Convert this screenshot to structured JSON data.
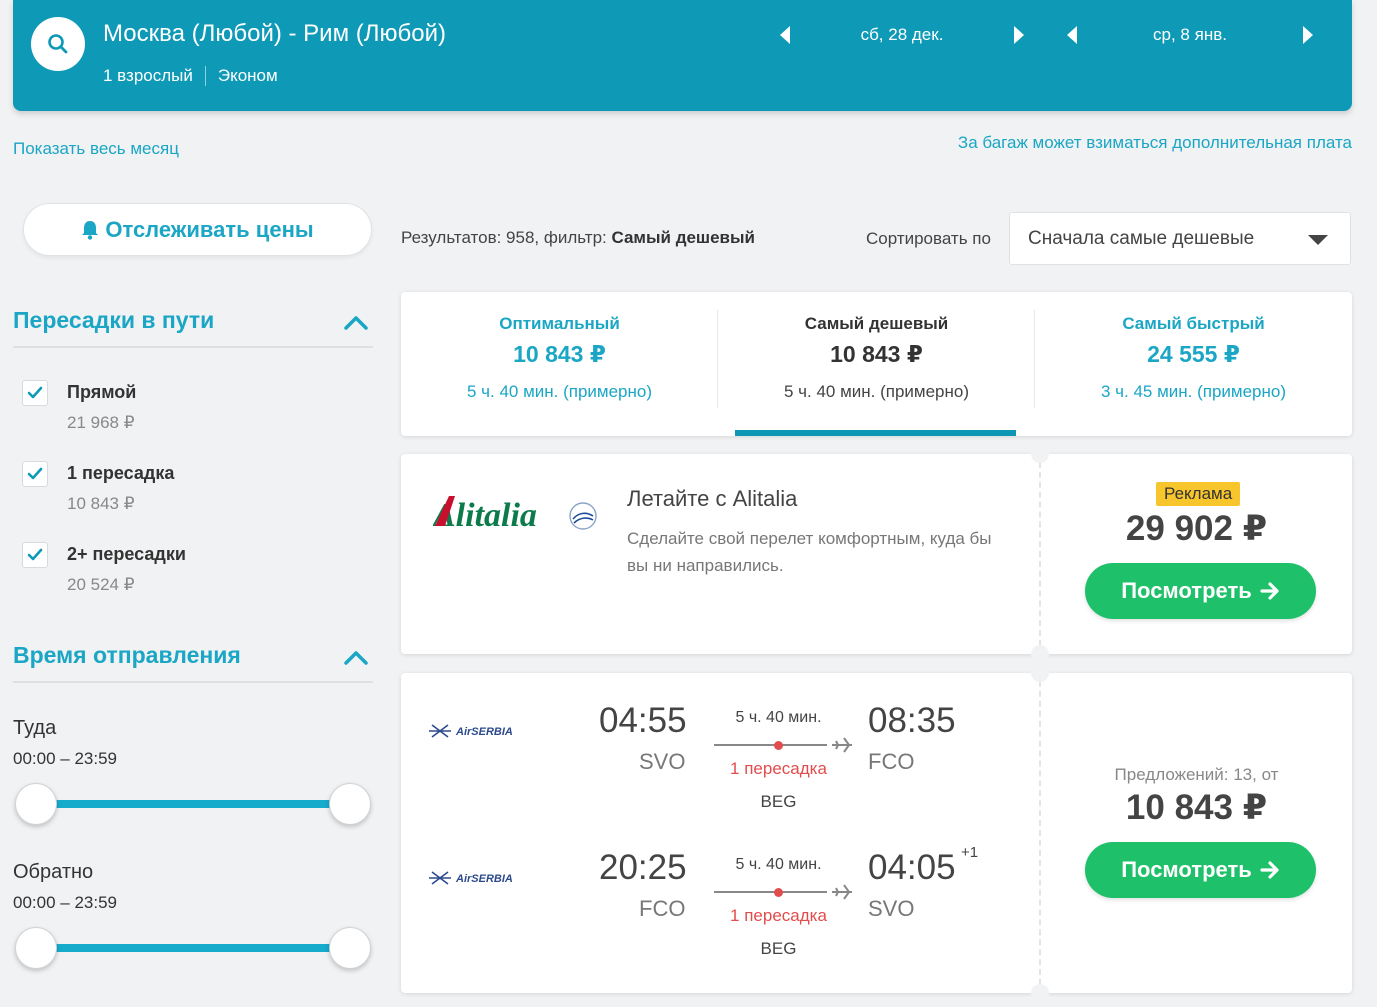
{
  "header": {
    "route": "Москва (Любой) - Рим (Любой)",
    "passengers": "1 взрослый",
    "cabin": "Эконом",
    "depart_date": "сб, 28 дек.",
    "return_date": "ср, 8 янв."
  },
  "links": {
    "show_month": "Показать весь месяц",
    "baggage_note": "За багаж может взиматься дополнительная плата"
  },
  "sidebar": {
    "track_prices": "Отслеживать цены",
    "stops_title": "Пересадки в пути",
    "stops": [
      {
        "label": "Прямой",
        "price": "21 968 ₽",
        "checked": true
      },
      {
        "label": "1 пересадка",
        "price": "10 843 ₽",
        "checked": true
      },
      {
        "label": "2+ пересадки",
        "price": "20 524 ₽",
        "checked": true
      }
    ],
    "departure_title": "Время отправления",
    "outbound": {
      "label": "Туда",
      "range": "00:00 – 23:59",
      "min": 0,
      "max": 1
    },
    "return": {
      "label": "Обратно",
      "range": "00:00 – 23:59",
      "min": 0,
      "max": 1
    }
  },
  "toolbar": {
    "results_prefix": "Результатов: 958, фильтр: ",
    "results_filter": "Самый дешевый",
    "sort_label": "Сортировать по",
    "sort_value": "Сначала самые дешевые"
  },
  "tabs": [
    {
      "name": "Оптимальный",
      "price": "10 843 ₽",
      "duration": "5 ч. 40 мин. (примерно)"
    },
    {
      "name": "Самый дешевый",
      "price": "10 843 ₽",
      "duration": "5 ч. 40 мин. (примерно)",
      "active": true
    },
    {
      "name": "Самый быстрый",
      "price": "24 555 ₽",
      "duration": "3 ч. 45 мин. (примерно)"
    }
  ],
  "ad": {
    "brand": "Alitalia",
    "title": "Летайте с Alitalia",
    "text": "Сделайте свой перелет комфортным, куда бы вы ни направились.",
    "badge": "Реклама",
    "price": "29 902 ₽",
    "button": "Посмотреть"
  },
  "flight": {
    "airline": "AirSERBIA",
    "offers": "Предложений: 13, от",
    "price": "10 843 ₽",
    "button": "Посмотреть",
    "legs": [
      {
        "dep_time": "04:55",
        "dep_airport": "SVO",
        "duration": "5 ч. 40 мин.",
        "stops": "1 пересадка",
        "via": "BEG",
        "arr_time": "08:35",
        "arr_airport": "FCO",
        "day_offset": ""
      },
      {
        "dep_time": "20:25",
        "dep_airport": "FCO",
        "duration": "5 ч. 40 мин.",
        "stops": "1 пересадка",
        "via": "BEG",
        "arr_time": "04:05",
        "arr_airport": "SVO",
        "day_offset": "+1"
      }
    ]
  },
  "colors": {
    "header": "#0e9ab7",
    "accent": "#1aa6c4",
    "button": "#1ec06a",
    "badge": "#f7c62c",
    "stop_red": "#e34c4c"
  }
}
